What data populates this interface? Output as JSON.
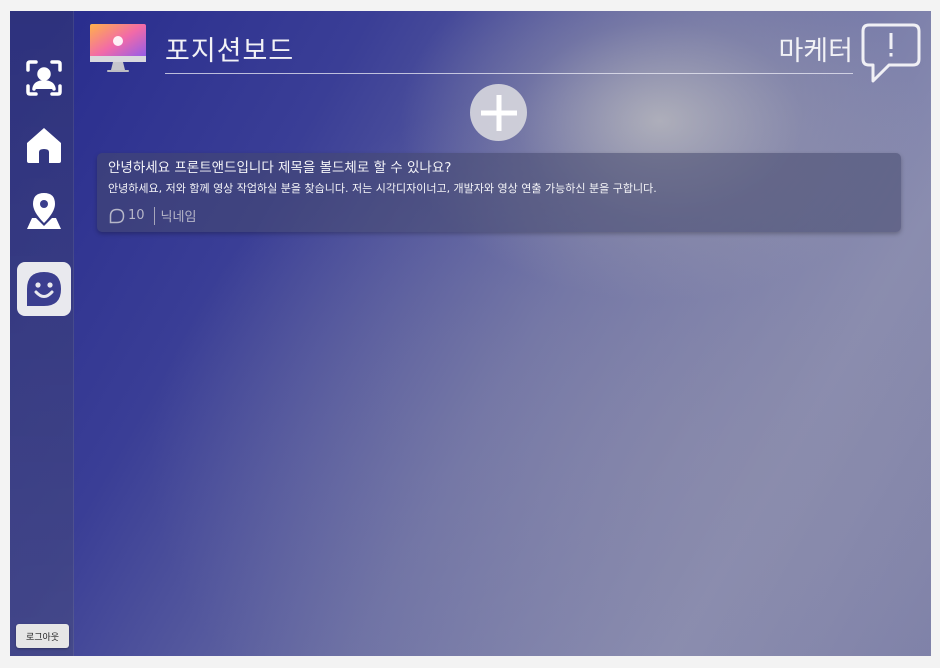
{
  "header": {
    "title": "포지션보드",
    "role": "마케터",
    "icons": {
      "logo": "monitor-icon",
      "chat": "chat-bubble-alert-icon"
    }
  },
  "sidebar": {
    "items": [
      {
        "icon": "profile-scan-icon"
      },
      {
        "icon": "home-icon"
      },
      {
        "icon": "location-icon"
      },
      {
        "icon": "smile-chat-icon",
        "active": true
      }
    ],
    "logout_label": "로그아웃"
  },
  "add_button": {
    "icon": "plus-icon"
  },
  "posts": [
    {
      "title": "안녕하세요 프론트앤드입니다 제목을 볼드체로 할 수 있나요?",
      "body": "안녕하세요, 저와 함께 영상 작업하실 분을 찾습니다.  저는 시각디자이너고, 개발자와 영상 연출 가능하신 분을 구합니다.",
      "comment_count": "10",
      "author": "닉네임"
    }
  ],
  "colors": {
    "background_dark": "#262a8c",
    "background_light": "#8a8db0",
    "sidebar_icon": "#ffffff",
    "active_icon": "#3b3e8f"
  }
}
